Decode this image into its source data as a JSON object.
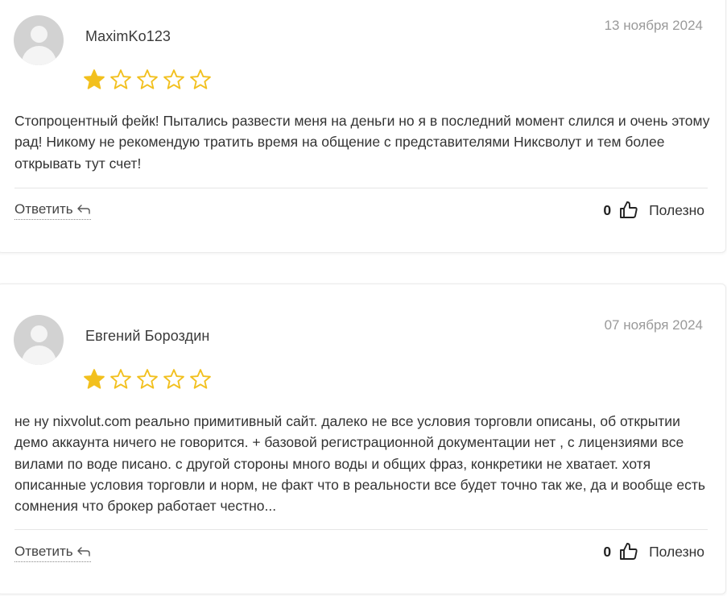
{
  "reviews": [
    {
      "author": "MaximKo123",
      "date": "13 ноября 2024",
      "rating": 1,
      "max_rating": 5,
      "star_color": "#f2c01e",
      "text": "Стопроцентный фейк! Пытались развести меня на деньги но я в последний момент слился и очень этому рад! Никому не рекомендую тратить время на общение с представителями Никсволут и тем более открывать тут счет!",
      "reply_label": "Ответить",
      "useful_count": "0",
      "useful_label": "Полезно"
    },
    {
      "author": "Евгений Бороздин",
      "date": "07 ноября 2024",
      "rating": 1,
      "max_rating": 5,
      "star_color": "#f2c01e",
      "text": "не ну nixvolut.com реально примитивный сайт. далеко не все условия торговли описаны, об открытии демо аккаунта ничего не говорится. + базовой регистрационной документации нет , с лицензиями все вилами по воде писано. с другой стороны много воды и общих фраз, конкретики не хватает. хотя описанные условия торговли и норм, не факт что в реальности все будет точно так же, да и вообще есть сомнения что брокер работает честно...",
      "reply_label": "Ответить",
      "useful_count": "0",
      "useful_label": "Полезно"
    }
  ]
}
